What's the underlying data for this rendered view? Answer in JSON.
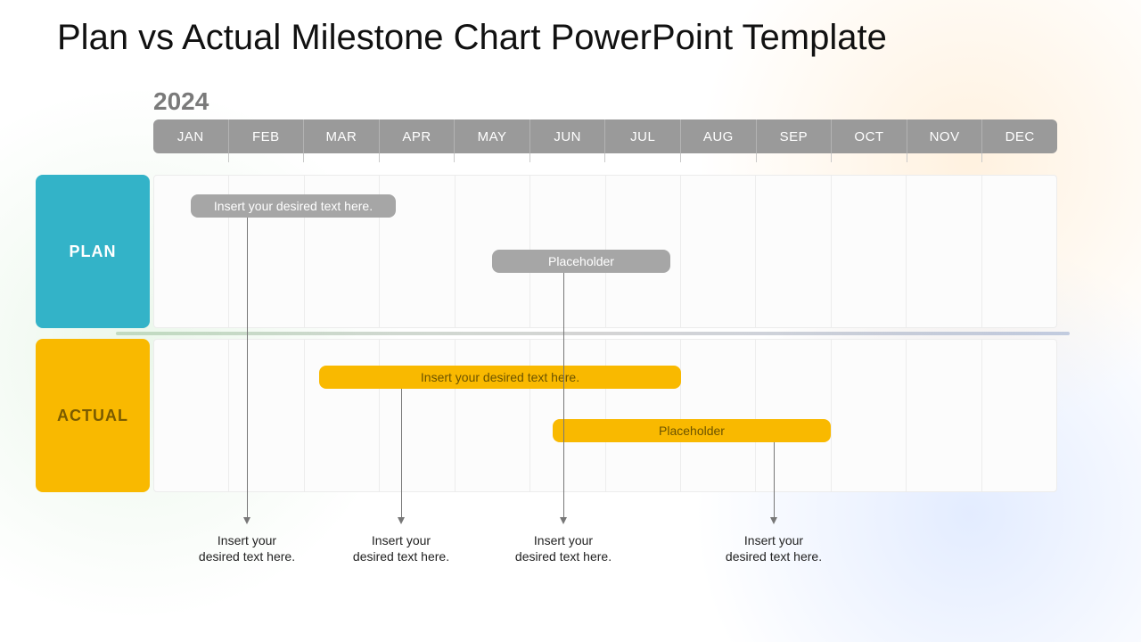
{
  "title": "Plan vs Actual Milestone Chart PowerPoint Template",
  "year": "2024",
  "months": [
    "JAN",
    "FEB",
    "MAR",
    "APR",
    "MAY",
    "JUN",
    "JUL",
    "AUG",
    "SEP",
    "OCT",
    "NOV",
    "DEC"
  ],
  "rows": {
    "plan_label": "PLAN",
    "actual_label": "ACTUAL"
  },
  "bars": {
    "plan1": {
      "label": "Insert your desired text here."
    },
    "plan2": {
      "label": "Placeholder"
    },
    "actual1": {
      "label": "Insert your desired text here."
    },
    "actual2": {
      "label": "Placeholder"
    }
  },
  "captions": {
    "c1": "Insert your\ndesired text here.",
    "c2": "Insert your\ndesired text here.",
    "c3": "Insert your\ndesired text here.",
    "c4": "Insert your\ndesired text here."
  },
  "colors": {
    "plan_row": "#33b3c8",
    "actual_row": "#f9b900",
    "plan_bar": "#a6a6a6",
    "actual_bar": "#f9b900"
  },
  "chart_data": {
    "type": "bar",
    "orientation": "horizontal-gantt",
    "x_axis": {
      "unit": "month",
      "year": 2024,
      "categories": [
        "JAN",
        "FEB",
        "MAR",
        "APR",
        "MAY",
        "JUN",
        "JUL",
        "AUG",
        "SEP",
        "OCT",
        "NOV",
        "DEC"
      ],
      "range": [
        1,
        12
      ]
    },
    "series": [
      {
        "name": "PLAN",
        "color": "#a6a6a6",
        "items": [
          {
            "label": "Insert your desired text here.",
            "start_month": 1.5,
            "end_month": 4.2
          },
          {
            "label": "Placeholder",
            "start_month": 5.5,
            "end_month": 7.8
          }
        ]
      },
      {
        "name": "ACTUAL",
        "color": "#f9b900",
        "items": [
          {
            "label": "Insert your desired text here.",
            "start_month": 3.2,
            "end_month": 8.0
          },
          {
            "label": "Placeholder",
            "start_month": 6.3,
            "end_month": 10.0
          }
        ]
      }
    ],
    "connectors": [
      {
        "from_series": "PLAN",
        "item_index": 0,
        "anchor_month": 2.2,
        "caption": "Insert your desired text here."
      },
      {
        "from_series": "ACTUAL",
        "item_index": 0,
        "anchor_month": 4.2,
        "caption": "Insert your desired text here."
      },
      {
        "from_series": "PLAN",
        "item_index": 1,
        "anchor_month": 6.4,
        "caption": "Insert your desired text here."
      },
      {
        "from_series": "ACTUAL",
        "item_index": 1,
        "anchor_month": 9.2,
        "caption": "Insert your desired text here."
      }
    ],
    "title": "Plan vs Actual Milestone Chart PowerPoint Template"
  }
}
